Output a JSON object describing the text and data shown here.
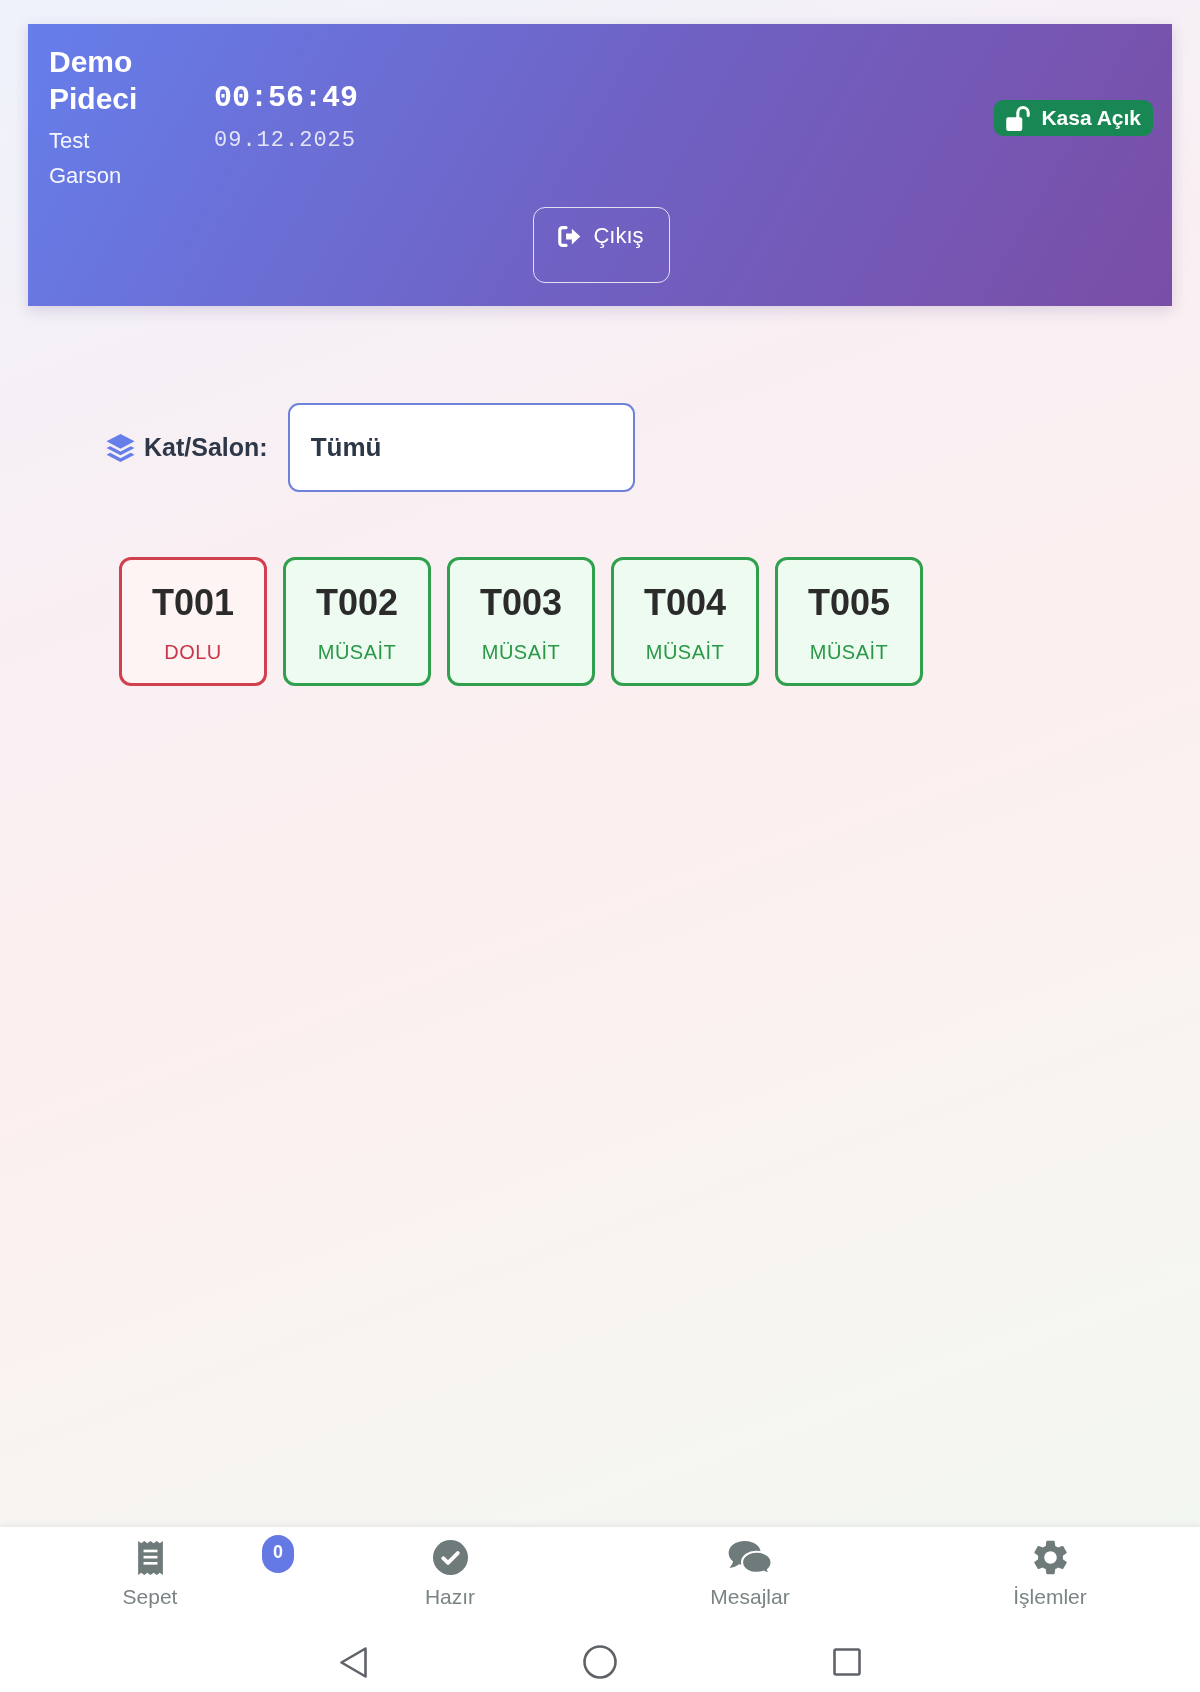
{
  "header": {
    "business_name": "Demo Pideci",
    "user_name": "Test Garson",
    "clock": {
      "time": "00:56:49",
      "date": "09.12.2025"
    },
    "register": {
      "label": "Kasa Açık",
      "open": true
    },
    "logout": {
      "label": "Çıkış"
    }
  },
  "filter": {
    "label": "Kat/Salon:",
    "value": "Tümü"
  },
  "tables": [
    {
      "name": "T001",
      "status": "DOLU",
      "kind": "occupied"
    },
    {
      "name": "T002",
      "status": "MÜSAİT",
      "kind": "available"
    },
    {
      "name": "T003",
      "status": "MÜSAİT",
      "kind": "available"
    },
    {
      "name": "T004",
      "status": "MÜSAİT",
      "kind": "available"
    },
    {
      "name": "T005",
      "status": "MÜSAİT",
      "kind": "available"
    }
  ],
  "bottom_nav": [
    {
      "label": "Sepet",
      "kind": "basket",
      "badge": "0"
    },
    {
      "label": "Hazır",
      "kind": "ready"
    },
    {
      "label": "Mesajlar",
      "kind": "messages"
    },
    {
      "label": "İşlemler",
      "kind": "settings"
    }
  ]
}
